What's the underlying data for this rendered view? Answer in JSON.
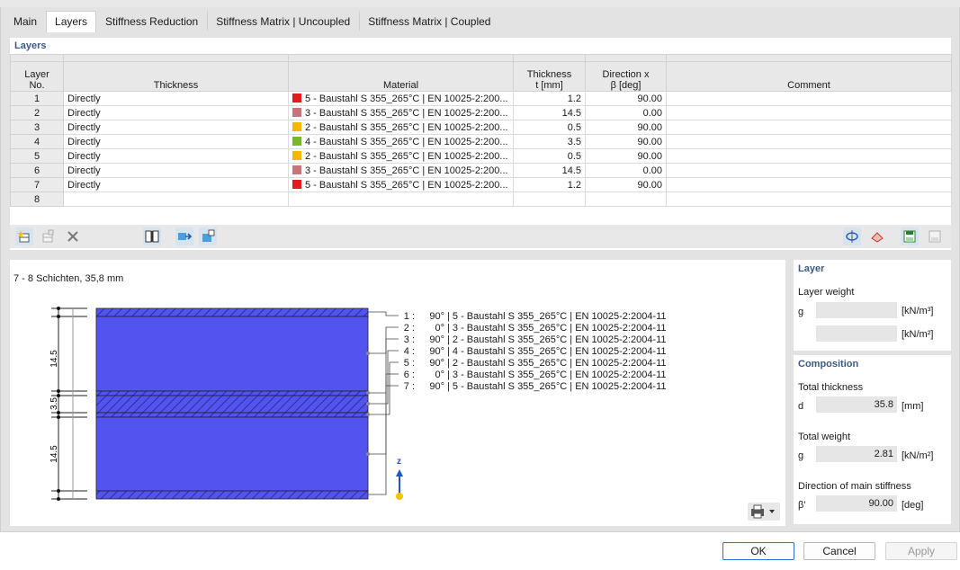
{
  "tabs": [
    {
      "label": "Main"
    },
    {
      "label": "Layers"
    },
    {
      "label": "Stiffness Reduction"
    },
    {
      "label": "Stiffness Matrix | Uncoupled"
    },
    {
      "label": "Stiffness Matrix | Coupled"
    }
  ],
  "layers_section": {
    "title": "Layers",
    "columns": {
      "no_1": "Layer",
      "no_2": "No.",
      "thickness": "Thickness",
      "material": "Material",
      "t_1": "Thickness",
      "t_2": "t [mm]",
      "dir_1": "Direction x",
      "dir_2": "β [deg]",
      "comment": "Comment"
    },
    "rows": [
      {
        "no": "1",
        "thickness": "Directly",
        "material": "5 - Baustahl S 355_265°C | EN 10025-2:200...",
        "color": "#e8191c",
        "t": "1.2",
        "beta": "90.00",
        "comment": ""
      },
      {
        "no": "2",
        "thickness": "Directly",
        "material": "3 - Baustahl S 355_265°C | EN 10025-2:200...",
        "color": "#c8757a",
        "t": "14.5",
        "beta": "0.00",
        "comment": ""
      },
      {
        "no": "3",
        "thickness": "Directly",
        "material": "2 - Baustahl S 355_265°C | EN 10025-2:200...",
        "color": "#f5b800",
        "t": "0.5",
        "beta": "90.00",
        "comment": ""
      },
      {
        "no": "4",
        "thickness": "Directly",
        "material": "4 - Baustahl S 355_265°C | EN 10025-2:200...",
        "color": "#76b82a",
        "t": "3.5",
        "beta": "90.00",
        "comment": ""
      },
      {
        "no": "5",
        "thickness": "Directly",
        "material": "2 - Baustahl S 355_265°C | EN 10025-2:200...",
        "color": "#f5b800",
        "t": "0.5",
        "beta": "90.00",
        "comment": ""
      },
      {
        "no": "6",
        "thickness": "Directly",
        "material": "3 - Baustahl S 355_265°C | EN 10025-2:200...",
        "color": "#c8757a",
        "t": "14.5",
        "beta": "0.00",
        "comment": ""
      },
      {
        "no": "7",
        "thickness": "Directly",
        "material": "5 - Baustahl S 355_265°C | EN 10025-2:200...",
        "color": "#e8191c",
        "t": "1.2",
        "beta": "90.00",
        "comment": ""
      },
      {
        "no": "8",
        "thickness": "",
        "material": "",
        "color": "",
        "t": "",
        "beta": "",
        "comment": ""
      }
    ]
  },
  "diagram": {
    "title": "7 - 8 Schichten, 35,8 mm",
    "dim_top": "14.5",
    "dim_mid": "3.5",
    "dim_bottom": "14.5",
    "axis_label": "z",
    "legend": [
      {
        "n": "1 :",
        "angle": "90°",
        "mat": "| 5 - Baustahl S 355_265°C | EN 10025-2:2004-11"
      },
      {
        "n": "2 :",
        "angle": "0°",
        "mat": "| 3 - Baustahl S 355_265°C | EN 10025-2:2004-11"
      },
      {
        "n": "3 :",
        "angle": "90°",
        "mat": "| 2 - Baustahl S 355_265°C | EN 10025-2:2004-11"
      },
      {
        "n": "4 :",
        "angle": "90°",
        "mat": "| 4 - Baustahl S 355_265°C | EN 10025-2:2004-11"
      },
      {
        "n": "5 :",
        "angle": "90°",
        "mat": "| 2 - Baustahl S 355_265°C | EN 10025-2:2004-11"
      },
      {
        "n": "6 :",
        "angle": "0°",
        "mat": "| 3 - Baustahl S 355_265°C | EN 10025-2:2004-11"
      },
      {
        "n": "7 :",
        "angle": "90°",
        "mat": "| 5 - Baustahl S 355_265°C | EN 10025-2:2004-11"
      }
    ]
  },
  "layer_panel": {
    "title": "Layer",
    "weight_label": "Layer weight",
    "g_symbol": "g",
    "unit1": "[kN/m³]",
    "unit2": "[kN/m²]",
    "value1": "",
    "value2": ""
  },
  "composition": {
    "title": "Composition",
    "total_thickness_label": "Total thickness",
    "d_symbol": "d",
    "d_value": "35.8",
    "d_unit": "[mm]",
    "total_weight_label": "Total weight",
    "g_symbol": "g",
    "g_value": "2.81",
    "g_unit": "[kN/m²]",
    "direction_label": "Direction of main stiffness",
    "beta_symbol": "β'",
    "beta_value": "90.00",
    "beta_unit": "[deg]"
  },
  "buttons": {
    "ok": "OK",
    "cancel": "Cancel",
    "apply": "Apply"
  },
  "colors": {
    "accent": "#3c5a86",
    "layer_fill": "#5353f0",
    "layer_hatch": "#3a3aa8",
    "axis": "#1f57c3"
  }
}
